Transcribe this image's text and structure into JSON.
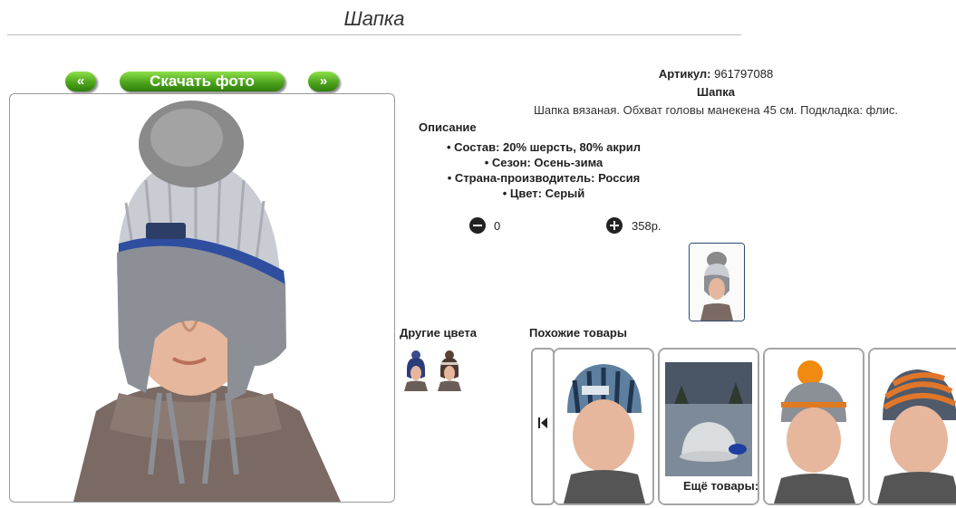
{
  "page": {
    "title": "Шапка"
  },
  "photo_nav": {
    "prev_label": "«",
    "download_label": "Скачать фото",
    "next_label": "»"
  },
  "product": {
    "article_label": "Артикул:",
    "article_value": "961797088",
    "name": "Шапка",
    "description": "Шапка вязаная. Обхват головы манекена 45 см. Подкладка: флис.",
    "description_heading": "Описание",
    "properties": [
      "• Состав: 20% шерсть, 80% акрил",
      "• Сезон: Осень-зима",
      "• Страна-производитель: Россия",
      "• Цвет: Серый"
    ],
    "quantity": "0",
    "price": "358р."
  },
  "sections": {
    "other_colors": "Другие цвета",
    "similar": "Похожие товары",
    "more": "Ещё товары:"
  },
  "carousel": {
    "prev_icon": "first-page-icon"
  },
  "icons": {
    "minus": "minus-circle-icon",
    "plus": "plus-circle-icon"
  },
  "colors": {
    "button_green": "#4ea51c",
    "thumb_border": "#2b4a73",
    "card_border": "#a5a5a5"
  }
}
